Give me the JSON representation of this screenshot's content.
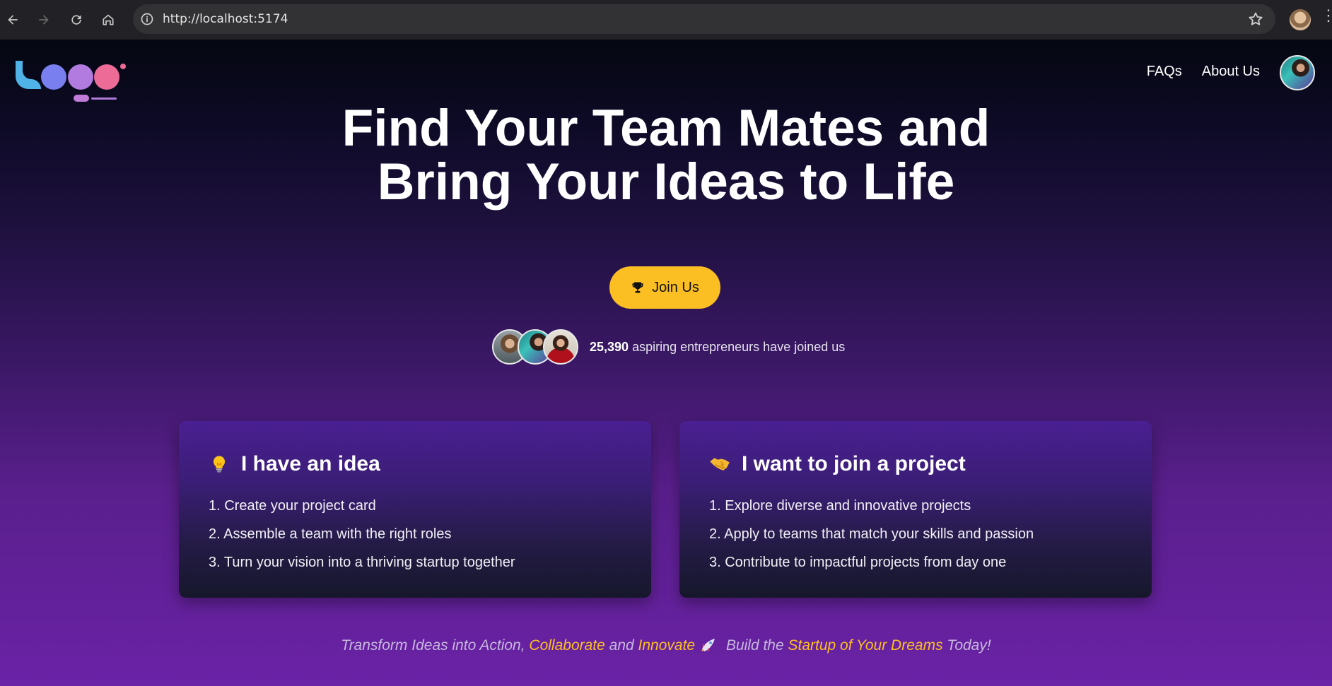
{
  "browser": {
    "url": "http://localhost:5174"
  },
  "nav": {
    "faqs": "FAQs",
    "about": "About Us"
  },
  "hero": {
    "title_line1": "Find Your Team Mates and",
    "title_line2": "Bring Your Ideas to Life",
    "join_label": "Join Us",
    "join_icon": "trophy-icon",
    "count": "25,390",
    "count_suffix": " aspiring entrepreneurs have joined us"
  },
  "cards": [
    {
      "icon": "lightbulb-icon",
      "title": "I have an idea",
      "items": [
        "1. Create your project card",
        "2. Assemble a team with the right roles",
        "3. Turn your vision into a thriving startup together"
      ]
    },
    {
      "icon": "handshake-icon",
      "title": "I want to join a project",
      "items": [
        "1. Explore diverse and innovative projects",
        "2. Apply to teams that match your skills and passion",
        "3. Contribute to impactful projects from day one"
      ]
    }
  ],
  "tagline": {
    "p1": "Transform Ideas into Action, ",
    "hl1": "Collaborate",
    "p2": " and ",
    "hl2": "Innovate",
    "p3": " Build the ",
    "hl3": "Startup of Your Dreams",
    "p4": " Today!"
  },
  "colors": {
    "accent": "#fbbf24",
    "page_bottom": "#6a22a6",
    "page_top": "#050711"
  }
}
